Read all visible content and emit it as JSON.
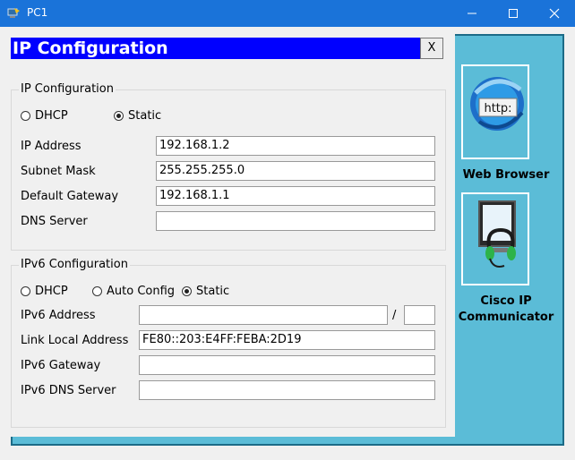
{
  "window": {
    "title": "PC1",
    "icon": "packet-tracer-pc-icon"
  },
  "desktop": {
    "apps": [
      {
        "label": "Web Browser",
        "icon": "web-browser-icon",
        "badge": "http:"
      },
      {
        "label": "Cisco IP Communicator",
        "icon": "ip-communicator-icon"
      }
    ]
  },
  "dialog": {
    "title": "IP Configuration",
    "close_label": "X"
  },
  "ipv4": {
    "legend": "IP Configuration",
    "dhcp_label": "DHCP",
    "static_label": "Static",
    "selected": "Static",
    "ip_label": "IP Address",
    "ip_value": "192.168.1.2",
    "mask_label": "Subnet Mask",
    "mask_value": "255.255.255.0",
    "gateway_label": "Default Gateway",
    "gateway_value": "192.168.1.1",
    "dns_label": "DNS Server",
    "dns_value": ""
  },
  "ipv6": {
    "legend": "IPv6 Configuration",
    "dhcp_label": "DHCP",
    "auto_label": "Auto Config",
    "static_label": "Static",
    "selected": "Static",
    "address_label": "IPv6 Address",
    "address_value": "",
    "slash": "/",
    "prefix_value": "",
    "link_local_label": "Link Local Address",
    "link_local_value": "FE80::203:E4FF:FEBA:2D19",
    "gateway_label": "IPv6 Gateway",
    "gateway_value": "",
    "dns_label": "IPv6 DNS Server",
    "dns_value": ""
  }
}
